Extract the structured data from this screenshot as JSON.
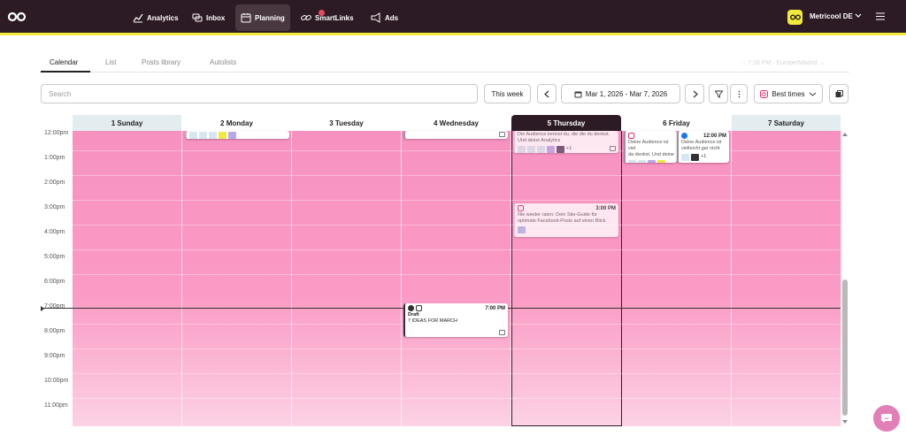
{
  "nav": {
    "items": [
      {
        "label": "Analytics",
        "icon": "chart-line-icon"
      },
      {
        "label": "Inbox",
        "icon": "chat-bubbles-icon"
      },
      {
        "label": "Planning",
        "icon": "calendar-icon",
        "active": true
      },
      {
        "label": "SmartLinks",
        "icon": "link-icon",
        "badge": true
      },
      {
        "label": "Ads",
        "icon": "megaphone-icon"
      }
    ],
    "brand": {
      "avatar_text": "oo",
      "name": "Metricool DE"
    },
    "accent": "#f2ea3b",
    "background": "#2c1b24"
  },
  "tabs": [
    {
      "label": "Calendar",
      "active": true
    },
    {
      "label": "List"
    },
    {
      "label": "Posts library"
    },
    {
      "label": "Autolists"
    }
  ],
  "timezone": {
    "label": "7:18 PM · Europe/Madrid"
  },
  "toolbar": {
    "search_placeholder": "Search",
    "this_week": "This week",
    "date_range": "Mar 1, 2026 - Mar 7, 2026",
    "best_times": "Best times"
  },
  "calendar": {
    "days": [
      {
        "label": "1 Sunday",
        "weekend": true
      },
      {
        "label": "2 Monday"
      },
      {
        "label": "3 Tuesday"
      },
      {
        "label": "4 Wednesday"
      },
      {
        "label": "5 Thursday",
        "today": true
      },
      {
        "label": "6 Friday"
      },
      {
        "label": "7 Saturday",
        "weekend": true
      }
    ],
    "hours": [
      "12:00pm",
      "1:00pm",
      "2:00pm",
      "3:00pm",
      "4:00pm",
      "5:00pm",
      "6:00pm",
      "7:00pm",
      "8:00pm",
      "9:00pm",
      "10:00pm",
      "11:00pm"
    ],
    "heat_color": "#f792c0"
  },
  "posts": {
    "thu_morning": {
      "text_1": "Die Audience kennst du, die die du denkst. Und deine Analytics",
      "more": "+1"
    },
    "thu_3pm": {
      "time": "3:00 PM",
      "text_1": "Nie wieder raten: Dein Stie-Guide für",
      "text_2": "optimale Facebook-Posts auf einen Blick"
    },
    "fri_a": {
      "text_1": "Deine Audience ist viel",
      "text_2": "da denkst. Und deine",
      "more": "+1"
    },
    "fri_b": {
      "time": "12:00 PM",
      "text_1": "Deine Audience ist",
      "text_2": "vielleicht gar nicht",
      "more": "+1"
    },
    "wed_7pm": {
      "time": "7:00 PM",
      "status": "Draft",
      "text_1": "7 IDEAS FOR MARCH"
    }
  }
}
